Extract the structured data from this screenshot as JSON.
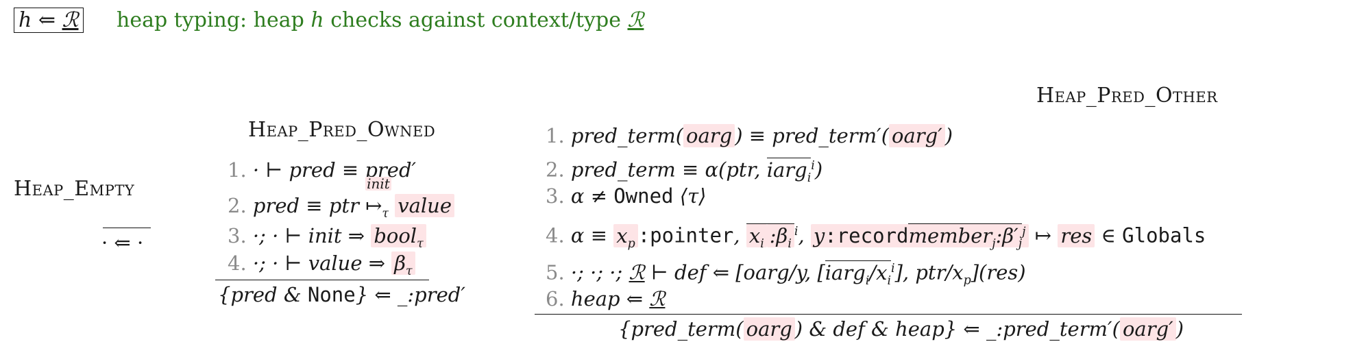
{
  "header": {
    "judgement_h": "h",
    "judgement_arrow": "⇐",
    "judgement_R": "ℛ",
    "description_prefix": "heap typing: heap ",
    "description_h": "h",
    "description_suffix": " checks against context/type ",
    "description_R": "ℛ"
  },
  "rules": {
    "empty": {
      "name": "Heap_Empty",
      "conclusion": "· ⇐ ·"
    },
    "owned": {
      "name": "Heap_Pred_Owned",
      "p1": {
        "n": "1.",
        "text": "· ⊢ pred ≡ pred′"
      },
      "p2": {
        "n": "2.",
        "a": "pred ≡ ptr ",
        "arrow": "↦",
        "sup": "init",
        "sub": "τ",
        "b": "value"
      },
      "p3": {
        "n": "3.",
        "a": "·; · ⊢ init ⇒ ",
        "b": "bool",
        "sub": "τ"
      },
      "p4": {
        "n": "4.",
        "a": "·; · ⊢ value ⇒ ",
        "b": "β",
        "sub": "τ"
      },
      "conclusion": {
        "a": "{pred & ",
        "none": "None",
        "b": "} ⇐ _:pred′"
      }
    },
    "other": {
      "name": "Heap_Pred_Other",
      "p1": {
        "n": "1.",
        "a": "pred_term(",
        "b": "oarg",
        "c": ") ≡ pred_term′(",
        "d": "oarg′",
        "e": ")"
      },
      "p2": {
        "n": "2.",
        "a": "pred_term ≡ α(ptr, ",
        "b": "iarg",
        "sub": "i",
        "sup": "i",
        "c": ")"
      },
      "p3": {
        "n": "3.",
        "a": "α ≠ ",
        "owned": "Owned",
        "b": "⟨τ⟩"
      },
      "p4": {
        "n": "4.",
        "a": "α ≡ ",
        "xp": "x",
        "xp_sub": "p",
        "pointer": ":pointer",
        "comma1": ", ",
        "xi": "x",
        "xi_sub": "i",
        "beta": ":β",
        "beta_sub": "i",
        "sup_i": "i",
        "comma2": ", ",
        "y": "y",
        "record": ":record",
        "member": "member",
        "member_sub": "j",
        "beta2": ":β′",
        "beta2_sub": "j",
        "sup_j": "j",
        "mapsto": " ↦ ",
        "res": "res",
        "in": " ∈ ",
        "globals": "Globals"
      },
      "p5": {
        "n": "5.",
        "a": "·; ·; ·; ",
        "R": "ℛ",
        "b": " ⊢ def ⇐ [oarg/y, [",
        "iarg": "iarg",
        "iarg_sub": "i",
        "slash": "/x",
        "x_sub": "i",
        "sup": "i",
        "c": "], ptr/x",
        "p_sub": "p",
        "d": "](res)"
      },
      "p6": {
        "n": "6.",
        "a": "heap ⇐ ",
        "R": "ℛ"
      },
      "conclusion": {
        "a": "{pred_term(",
        "b": "oarg",
        "c": ") & def & heap} ⇐ _:pred_term′(",
        "d": "oarg′",
        "e": ")"
      }
    }
  }
}
